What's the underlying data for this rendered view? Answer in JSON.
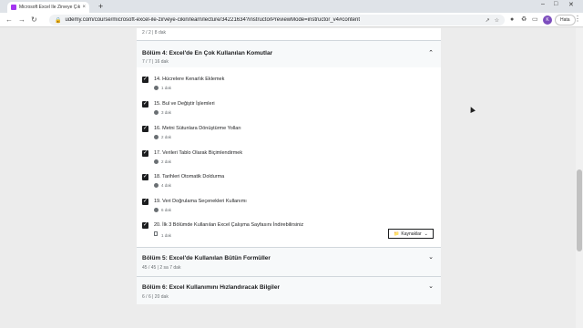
{
  "browser": {
    "tab_title": "Microsoft Excel İle Zirveye Çıkın",
    "tab_close": "×",
    "new_tab": "+",
    "url": "udemy.com/course/microsoft-excel-ile-zirveye-cikin/learn/lecture/34221634?instructorPreviewMode=instructor_v4#content",
    "profile_initial": "K",
    "hata_label": "Hata",
    "icons": [
      "back-icon",
      "forward-icon",
      "reload-icon",
      "lock-icon",
      "share-icon",
      "star-icon",
      "extensions-icon",
      "sidebar-icon",
      "menu-icon"
    ]
  },
  "page": {
    "prev_section_sub": "2 / 2 | 8 dak",
    "section4": {
      "title": "Bölüm 4: Excel'de En Çok Kullanılan Komutlar",
      "sub": "7 / 7 | 16 dak"
    },
    "items": [
      {
        "title": "14. Hücrelere Kenarlık Eklemek",
        "duration": "1 dak"
      },
      {
        "title": "15. Bul ve Değiştir İşlemleri",
        "duration": "3 dak"
      },
      {
        "title": "16. Metni Sütunlara Dönüştürme Yolları",
        "duration": "2 dak"
      },
      {
        "title": "17. Verileri Tablo Olarak Biçimlendirmek",
        "duration": "2 dak"
      },
      {
        "title": "18. Tarihleri Otomatik Doldurma",
        "duration": "4 dak"
      },
      {
        "title": "19. Veri Doğrulama Seçenekleri Kullanımı",
        "duration": "6 dak"
      },
      {
        "title": "20. İlk 3 Bölümde Kullanılan Excel Çalışma Sayfasını İndirebilirsiniz",
        "duration": "1 dak"
      }
    ],
    "resources_label": "Kaynaklar",
    "section5": {
      "title": "Bölüm 5: Excel'de Kullanılan Bütün Formüller",
      "sub": "45 / 45 | 2 sa 7 dak"
    },
    "section6": {
      "title": "Bölüm 6: Excel Kullanımını Hızlandıracak Bilgiler",
      "sub": "6 / 6 | 20 dak"
    }
  }
}
